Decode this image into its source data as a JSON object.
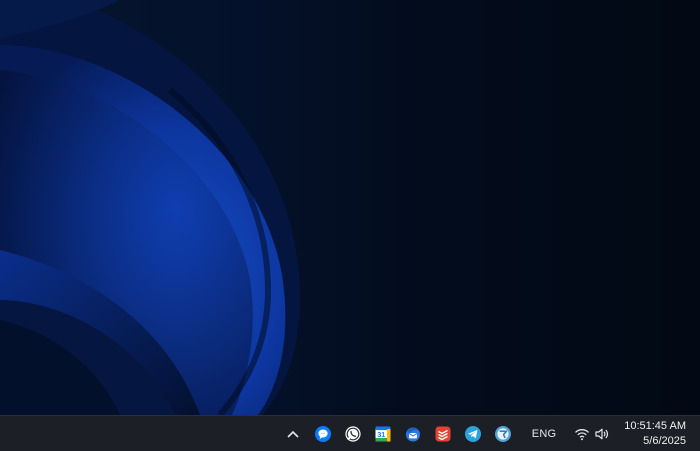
{
  "desktop": {
    "wallpaper": "windows-11-bloom-dark",
    "colors": {
      "base": "#030a16",
      "bloom_light": "#1444b8",
      "bloom_dark": "#061a4a"
    }
  },
  "taskbar": {
    "background": "#1c2026",
    "tray": {
      "overflow_icon": "chevron-up-icon",
      "apps": [
        {
          "name": "messenger-icon",
          "color": "#0a7cff"
        },
        {
          "name": "whatsapp-icon",
          "color": "#ffffff"
        },
        {
          "name": "google-calendar-icon",
          "color": "#1a73e8",
          "label": "31"
        },
        {
          "name": "thunderbird-icon",
          "color": "#2a7ae2"
        },
        {
          "name": "todoist-icon",
          "color": "#e44332"
        },
        {
          "name": "telegram-icon",
          "color": "#2aa3df"
        },
        {
          "name": "chrome-remote-icon",
          "color": "#4fa3d9"
        }
      ],
      "language": "ENG",
      "wifi_icon": "wifi-icon",
      "volume_icon": "speaker-icon"
    },
    "clock": {
      "time": "10:51:45 AM",
      "date": "5/6/2025"
    }
  }
}
